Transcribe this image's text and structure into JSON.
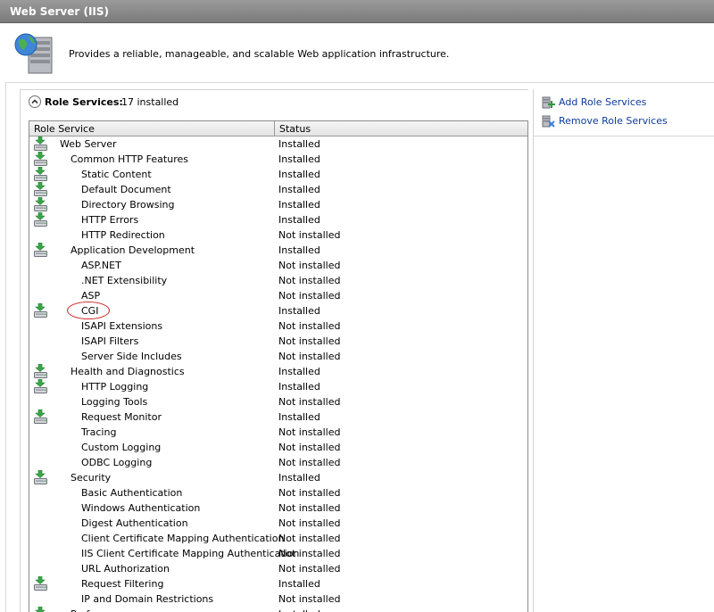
{
  "window": {
    "title": "Web Server (IIS)"
  },
  "header": {
    "description": "Provides a reliable, manageable, and scalable Web application infrastructure.",
    "icon": "server-globe-icon"
  },
  "section": {
    "title": "Role Services:",
    "count": "17 installed"
  },
  "columns": {
    "role_service": "Role Service",
    "status": "Status"
  },
  "rows": [
    {
      "name": "Web Server",
      "status": "Installed",
      "level": 0,
      "installed": true
    },
    {
      "name": "Common HTTP Features",
      "status": "Installed",
      "level": 1,
      "installed": true
    },
    {
      "name": "Static Content",
      "status": "Installed",
      "level": 2,
      "installed": true
    },
    {
      "name": "Default Document",
      "status": "Installed",
      "level": 2,
      "installed": true
    },
    {
      "name": "Directory Browsing",
      "status": "Installed",
      "level": 2,
      "installed": true
    },
    {
      "name": "HTTP Errors",
      "status": "Installed",
      "level": 2,
      "installed": true
    },
    {
      "name": "HTTP Redirection",
      "status": "Not installed",
      "level": 2,
      "installed": false
    },
    {
      "name": "Application Development",
      "status": "Installed",
      "level": 1,
      "installed": true
    },
    {
      "name": "ASP.NET",
      "status": "Not installed",
      "level": 2,
      "installed": false
    },
    {
      "name": ".NET Extensibility",
      "status": "Not installed",
      "level": 2,
      "installed": false
    },
    {
      "name": "ASP",
      "status": "Not installed",
      "level": 2,
      "installed": false
    },
    {
      "name": "CGI",
      "status": "Installed",
      "level": 2,
      "installed": true
    },
    {
      "name": "ISAPI Extensions",
      "status": "Not installed",
      "level": 2,
      "installed": false
    },
    {
      "name": "ISAPI Filters",
      "status": "Not installed",
      "level": 2,
      "installed": false
    },
    {
      "name": "Server Side Includes",
      "status": "Not installed",
      "level": 2,
      "installed": false
    },
    {
      "name": "Health and Diagnostics",
      "status": "Installed",
      "level": 1,
      "installed": true
    },
    {
      "name": "HTTP Logging",
      "status": "Installed",
      "level": 2,
      "installed": true
    },
    {
      "name": "Logging Tools",
      "status": "Not installed",
      "level": 2,
      "installed": false
    },
    {
      "name": "Request Monitor",
      "status": "Installed",
      "level": 2,
      "installed": true
    },
    {
      "name": "Tracing",
      "status": "Not installed",
      "level": 2,
      "installed": false
    },
    {
      "name": "Custom Logging",
      "status": "Not installed",
      "level": 2,
      "installed": false
    },
    {
      "name": "ODBC Logging",
      "status": "Not installed",
      "level": 2,
      "installed": false
    },
    {
      "name": "Security",
      "status": "Installed",
      "level": 1,
      "installed": true
    },
    {
      "name": "Basic Authentication",
      "status": "Not installed",
      "level": 2,
      "installed": false
    },
    {
      "name": "Windows Authentication",
      "status": "Not installed",
      "level": 2,
      "installed": false
    },
    {
      "name": "Digest Authentication",
      "status": "Not installed",
      "level": 2,
      "installed": false
    },
    {
      "name": "Client Certificate Mapping Authentication",
      "status": "Not installed",
      "level": 2,
      "installed": false
    },
    {
      "name": "IIS Client Certificate Mapping Authentication",
      "status": "Not installed",
      "level": 2,
      "installed": false
    },
    {
      "name": "URL Authorization",
      "status": "Not installed",
      "level": 2,
      "installed": false
    },
    {
      "name": "Request Filtering",
      "status": "Installed",
      "level": 2,
      "installed": true
    },
    {
      "name": "IP and Domain Restrictions",
      "status": "Not installed",
      "level": 2,
      "installed": false
    },
    {
      "name": "Performance",
      "status": "Installed",
      "level": 1,
      "installed": true
    }
  ],
  "actions": [
    {
      "label": "Add Role Services",
      "icon": "add-role-services-icon"
    },
    {
      "label": "Remove Role Services",
      "icon": "remove-role-services-icon"
    }
  ],
  "colors": {
    "link": "#0b3b9c",
    "highlight": "#d02a2a",
    "installed_arrow": "#3aa64a"
  }
}
